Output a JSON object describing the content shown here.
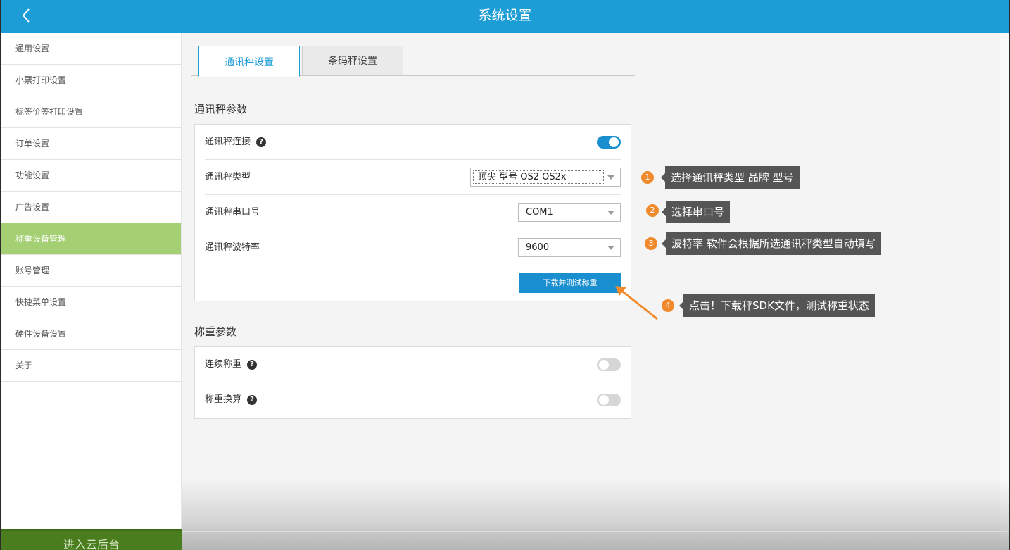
{
  "header": {
    "title": "系统设置",
    "back_icon": "chevron-left-icon"
  },
  "sidebar": {
    "items": [
      {
        "label": "通用设置",
        "active": false
      },
      {
        "label": "小票打印设置",
        "active": false
      },
      {
        "label": "标签价签打印设置",
        "active": false
      },
      {
        "label": "订单设置",
        "active": false
      },
      {
        "label": "功能设置",
        "active": false
      },
      {
        "label": "广告设置",
        "active": false
      },
      {
        "label": "称重设备管理",
        "active": true
      },
      {
        "label": "账号管理",
        "active": false
      },
      {
        "label": "快捷菜单设置",
        "active": false
      },
      {
        "label": "硬件设备设置",
        "active": false
      },
      {
        "label": "关于",
        "active": false
      }
    ],
    "cloud_button": "进入云后台"
  },
  "tabs": [
    {
      "label": "通讯秤设置",
      "active": true
    },
    {
      "label": "条码秤设置",
      "active": false
    }
  ],
  "comm_scale": {
    "section_title": "通讯秤参数",
    "connect_label": "通讯秤连接",
    "connect_on": true,
    "type_label": "通讯秤类型",
    "type_value": "顶尖 型号 OS2 OS2x",
    "port_label": "通讯秤串口号",
    "port_value": "COM1",
    "baud_label": "通讯秤波特率",
    "baud_value": "9600",
    "download_button": "下载并测试称重"
  },
  "weigh_params": {
    "section_title": "称重参数",
    "continuous_label": "连续称重",
    "continuous_on": false,
    "convert_label": "称重换算",
    "convert_on": false
  },
  "callouts": [
    {
      "num": "1",
      "text": "选择通讯秤类型 品牌 型号"
    },
    {
      "num": "2",
      "text": "选择串口号"
    },
    {
      "num": "3",
      "text": "波特率 软件会根据所选通讯秤类型自动填写"
    },
    {
      "num": "4",
      "text": "点击！下载秤SDK文件，测试称重状态"
    }
  ],
  "colors": {
    "primary": "#1d9dd6",
    "active_menu": "#a4cf72",
    "callout_badge": "#f08a2c",
    "callout_bg": "#555555"
  }
}
